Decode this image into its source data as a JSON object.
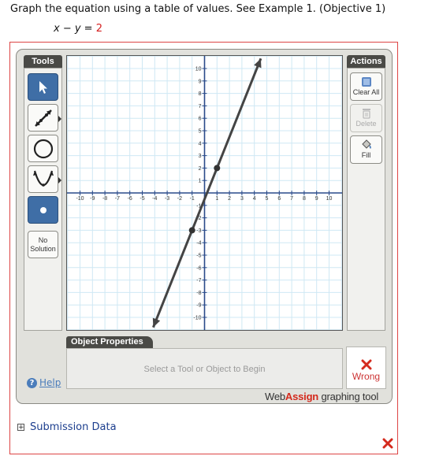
{
  "question": {
    "text": "Graph the equation using a table of values. See Example 1. (Objective 1)",
    "equation_lhs": "x − y = ",
    "equation_rhs": "2"
  },
  "tools_panel": {
    "title": "Tools",
    "items": [
      {
        "name": "pointer-tool",
        "icon": "arrow-pointer-icon",
        "active": true
      },
      {
        "name": "line-tool",
        "icon": "line-segment-icon",
        "active": false
      },
      {
        "name": "circle-tool",
        "icon": "circle-icon",
        "active": false
      },
      {
        "name": "parabola-tool",
        "icon": "parabola-icon",
        "active": false
      },
      {
        "name": "point-tool",
        "icon": "dot-icon",
        "active": true
      }
    ],
    "no_solution_line1": "No",
    "no_solution_line2": "Solution"
  },
  "actions_panel": {
    "title": "Actions",
    "clear_all": "Clear All",
    "delete": "Delete",
    "fill": "Fill"
  },
  "graph": {
    "x_ticks": [
      "-10",
      "-9",
      "-8",
      "-7",
      "-6",
      "-5",
      "-4",
      "-3",
      "-2",
      "-1",
      "1",
      "2",
      "3",
      "4",
      "5",
      "6",
      "7",
      "8",
      "9",
      "10"
    ],
    "y_ticks": [
      "10",
      "9",
      "8",
      "7",
      "6",
      "5",
      "4",
      "3",
      "2",
      "1",
      "-1",
      "-2",
      "-3",
      "-4",
      "-5",
      "-6",
      "-7",
      "-8",
      "-9",
      "-10"
    ],
    "xlim": [
      -11,
      11
    ],
    "ylim": [
      -11,
      11
    ],
    "line_points": [
      [
        -1,
        -3
      ],
      [
        1,
        2
      ]
    ],
    "line_color": "#444444",
    "point_color": "#333333",
    "axis_color": "#2a4a8a",
    "grid_color": "#cfe8f4"
  },
  "object_properties": {
    "title": "Object Properties",
    "placeholder": "Select a Tool or Object to Begin"
  },
  "result": {
    "label": "Wrong",
    "color": "#cc3333"
  },
  "help_label": "Help",
  "brand": {
    "web": "Web",
    "assign": "Assign",
    "suffix": " graphing tool"
  },
  "submission_label": "Submission Data"
}
